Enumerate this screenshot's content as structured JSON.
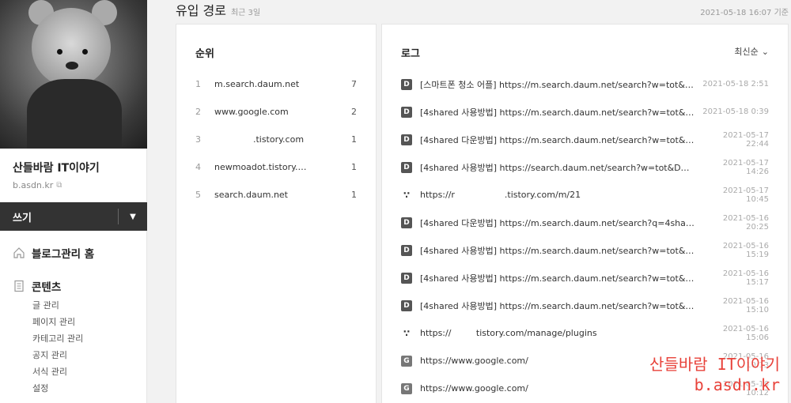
{
  "sidebar": {
    "blog_title": "산들바람 IT이야기",
    "blog_url": "b.asdn.kr",
    "write_label": "쓰기",
    "menu": {
      "home": "블로그관리 홈",
      "contents": "콘텐츠",
      "items": [
        "글 관리",
        "페이지 관리",
        "카테고리 관리",
        "공지 관리",
        "서식 관리",
        "설정"
      ]
    }
  },
  "header": {
    "title": "유입 경로",
    "subtitle": "최근 3일",
    "timestamp": "2021-05-18 16:07 기준"
  },
  "rank": {
    "title": "순위",
    "rows": [
      {
        "num": "1",
        "host": "m.search.daum.net",
        "count": "7"
      },
      {
        "num": "2",
        "host": "www.google.com",
        "count": "2"
      },
      {
        "num": "3",
        "host": "              .tistory.com",
        "count": "1"
      },
      {
        "num": "4",
        "host": "newmoadot.tistory.…",
        "count": "1"
      },
      {
        "num": "5",
        "host": "search.daum.net",
        "count": "1"
      }
    ]
  },
  "log": {
    "title": "로그",
    "sort_label": "최신순",
    "rows": [
      {
        "icon": "daum",
        "icon_label": "D",
        "text": "[스마트폰 청소 어플] https://m.search.daum.net/search?w=tot&q=…",
        "time": "2021-05-18 2:51"
      },
      {
        "icon": "daum",
        "icon_label": "D",
        "text": "[4shared 사용방법] https://m.search.daum.net/search?w=tot&q=…",
        "time": "2021-05-18 0:39"
      },
      {
        "icon": "daum",
        "icon_label": "D",
        "text": "[4shared 다운방법] https://m.search.daum.net/search?w=tot&q=…",
        "time": "2021-05-17 22:44"
      },
      {
        "icon": "daum",
        "icon_label": "D",
        "text": "[4shared 사용방법] https://search.daum.net/search?w=tot&DA=…",
        "time": "2021-05-17 14:26"
      },
      {
        "icon": "tistory",
        "icon_label": "∵",
        "text": "https://r                  .tistory.com/m/21",
        "time": "2021-05-17 10:45"
      },
      {
        "icon": "daum",
        "icon_label": "D",
        "text": "[4shared 다운방법] https://m.search.daum.net/search?q=4share…",
        "time": "2021-05-16 20:25"
      },
      {
        "icon": "daum",
        "icon_label": "D",
        "text": "[4shared 사용방법] https://m.search.daum.net/search?w=tot&q=…",
        "time": "2021-05-16 15:19"
      },
      {
        "icon": "daum",
        "icon_label": "D",
        "text": "[4shared 사용방법] https://m.search.daum.net/search?w=tot&q=…",
        "time": "2021-05-16 15:17"
      },
      {
        "icon": "daum",
        "icon_label": "D",
        "text": "[4shared 사용방법] https://m.search.daum.net/search?w=tot&q=…",
        "time": "2021-05-16 15:10"
      },
      {
        "icon": "tistory",
        "icon_label": "∵",
        "text": "https://         tistory.com/manage/plugins",
        "time": "2021-05-16 15:06"
      },
      {
        "icon": "google",
        "icon_label": "G",
        "text": "https://www.google.com/",
        "time": "2021-05-16 10:13"
      },
      {
        "icon": "google",
        "icon_label": "G",
        "text": "https://www.google.com/",
        "time": "2021-05-16 10:12"
      }
    ]
  },
  "watermark": {
    "line1": "산들바람 IT이야기",
    "line2": "b.asdn.kr"
  }
}
